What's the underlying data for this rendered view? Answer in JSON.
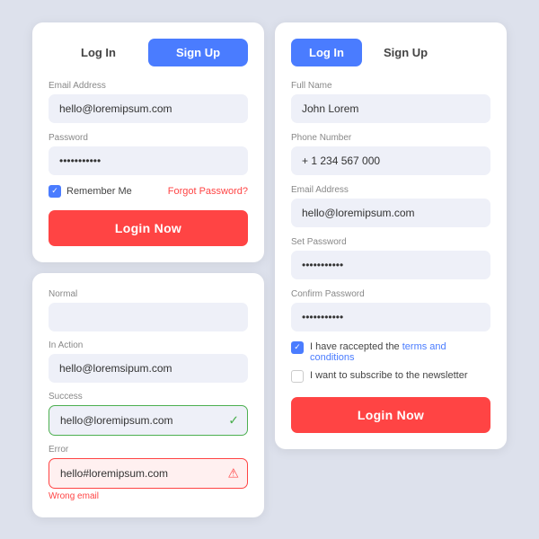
{
  "colors": {
    "accent_blue": "#4a7cff",
    "accent_red": "#f44444",
    "bg": "#dde1ec",
    "card_bg": "#fff",
    "input_bg": "#eef0f8"
  },
  "login_card": {
    "tab_login": "Log In",
    "tab_signup": "Sign Up",
    "email_label": "Email Address",
    "email_value": "hello@loremipsum.com",
    "password_label": "Password",
    "password_value": "············",
    "remember_label": "Remember Me",
    "forgot_label": "Forgot Password?",
    "login_btn": "Login Now"
  },
  "states_card": {
    "normal_label": "Normal",
    "normal_value": "",
    "in_action_label": "In Action",
    "in_action_value": "hello@loremsipum.com",
    "success_label": "Success",
    "success_value": "hello@loremipsum.com",
    "error_label": "Error",
    "error_value": "hello#loremipsum.com",
    "error_msg": "Wrong email"
  },
  "signup_card": {
    "tab_login": "Log In",
    "tab_signup": "Sign Up",
    "fullname_label": "Full Name",
    "fullname_value": "John Lorem",
    "phone_label": "Phone Number",
    "phone_value": "+ 1 234 567 000",
    "email_label": "Email Address",
    "email_value": "hello@loremipsum.com",
    "set_password_label": "Set Password",
    "set_password_value": "············",
    "confirm_password_label": "Confirm Password",
    "confirm_password_value": "············",
    "terms_text1": "I have raccepted the ",
    "terms_link": "terms and conditions",
    "newsletter_label": "I want to subscribe to the newsletter",
    "login_btn": "Login Now"
  }
}
